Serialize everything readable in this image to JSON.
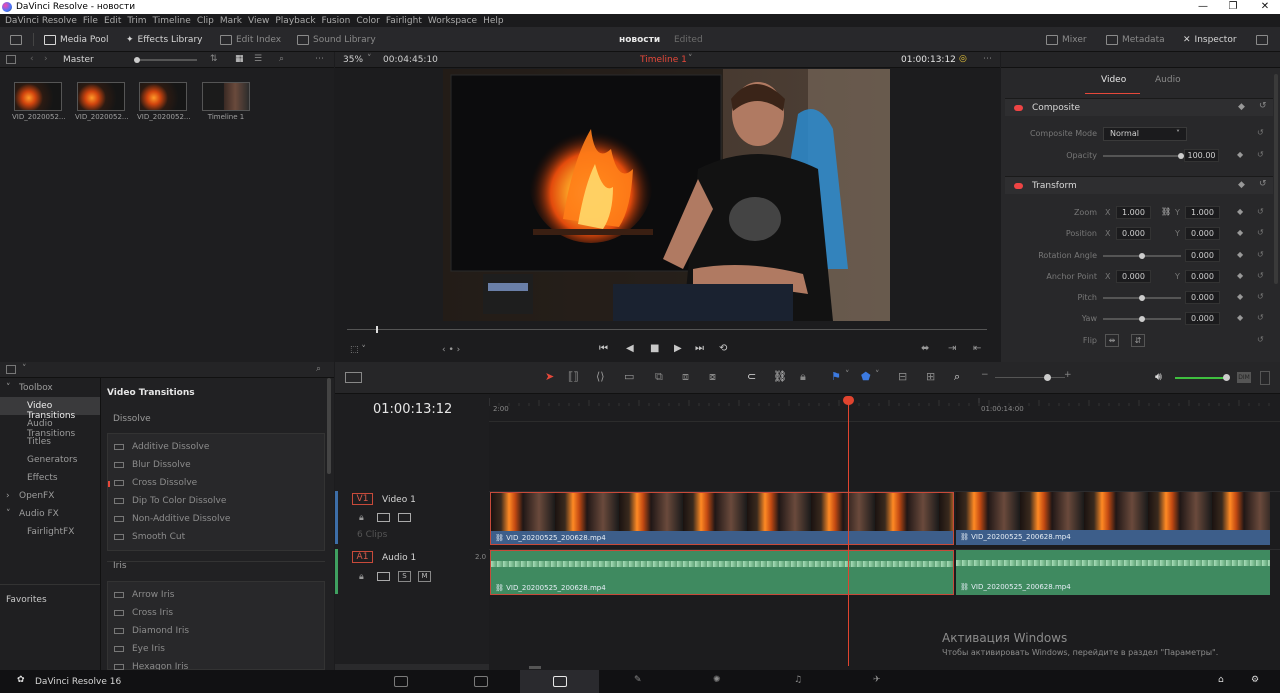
{
  "window": {
    "title": "DaVinci Resolve - новости",
    "controls": [
      "—",
      "❐",
      "✕"
    ]
  },
  "menu": [
    "DaVinci Resolve",
    "File",
    "Edit",
    "Trim",
    "Timeline",
    "Clip",
    "Mark",
    "View",
    "Playback",
    "Fusion",
    "Color",
    "Fairlight",
    "Workspace",
    "Help"
  ],
  "toolbar": {
    "media_pool": "Media Pool",
    "effects_library": "Effects Library",
    "edit_index": "Edit Index",
    "sound_library": "Sound Library",
    "project_name": "новости",
    "project_status": "Edited",
    "mixer": "Mixer",
    "metadata": "Metadata",
    "inspector": "Inspector"
  },
  "media_pool": {
    "bin": "Master",
    "clips": [
      {
        "label": "VID_2020052..."
      },
      {
        "label": "VID_2020052..."
      },
      {
        "label": "VID_2020052..."
      },
      {
        "label": "Timeline 1"
      }
    ]
  },
  "viewer": {
    "zoom": "35%",
    "duration": "00:04:45:10",
    "timeline_name": "Timeline 1",
    "timecode": "01:00:13:12"
  },
  "inspector": {
    "tabs": [
      "Video",
      "Audio"
    ],
    "active_tab": "Video",
    "composite": {
      "title": "Composite",
      "mode_label": "Composite Mode",
      "mode_value": "Normal",
      "opacity_label": "Opacity",
      "opacity_value": "100.00",
      "opacity_fraction": 1.0
    },
    "transform": {
      "title": "Transform",
      "zoom_label": "Zoom",
      "zoom_x": "1.000",
      "zoom_y": "1.000",
      "position_label": "Position",
      "position_x": "0.000",
      "position_y": "0.000",
      "rotation_label": "Rotation Angle",
      "rotation_value": "0.000",
      "anchor_label": "Anchor Point",
      "anchor_x": "0.000",
      "anchor_y": "0.000",
      "pitch_label": "Pitch",
      "pitch_value": "0.000",
      "yaw_label": "Yaw",
      "yaw_value": "0.000",
      "flip_label": "Flip",
      "axis_x": "X",
      "axis_y": "Y"
    }
  },
  "toolbox": {
    "tree": [
      {
        "label": "Toolbox",
        "arrow": "˅"
      },
      {
        "label": "Video Transitions",
        "selected": true
      },
      {
        "label": "Audio Transitions"
      },
      {
        "label": "Titles"
      },
      {
        "label": "Generators"
      },
      {
        "label": "Effects"
      },
      {
        "label": "OpenFX",
        "arrow": "›"
      },
      {
        "label": "Audio FX",
        "arrow": "˅"
      },
      {
        "label": "FairlightFX"
      }
    ],
    "favorites": "Favorites",
    "list_title": "Video Transitions",
    "groups": [
      {
        "name": "Dissolve",
        "items": [
          "Additive Dissolve",
          "Blur Dissolve",
          "Cross Dissolve",
          "Dip To Color Dissolve",
          "Non-Additive Dissolve",
          "Smooth Cut"
        ]
      },
      {
        "name": "Iris",
        "items": [
          "Arrow Iris",
          "Cross Iris",
          "Diamond Iris",
          "Eye Iris",
          "Hexagon Iris"
        ]
      }
    ]
  },
  "timeline": {
    "timecode": "01:00:13:12",
    "ruler_marks": [
      "2:00",
      "01:00:14:00"
    ],
    "video_track": {
      "badge": "V1",
      "name": "Video 1",
      "clip_count": "6 Clips"
    },
    "audio_track": {
      "badge": "A1",
      "name": "Audio 1",
      "channels": "2.0",
      "solo": "S",
      "mute": "M"
    },
    "clip_name": "VID_20200525_200628.mp4"
  },
  "bottombar": {
    "app_label": "DaVinci Resolve 16",
    "pages": [
      "media-page",
      "cut-page",
      "edit-page",
      "fusion-page",
      "color-page",
      "fairlight-page",
      "deliver-page"
    ],
    "active_page": "edit-page"
  },
  "watermark": {
    "title": "Активация Windows",
    "subtitle": "Чтобы активировать Windows, перейдите в раздел \"Параметры\"."
  },
  "colors": {
    "accent_red": "#e6483a",
    "video_clip": "#3d5e8a",
    "audio_clip": "#3f8a60",
    "playhead": "#e0442f"
  }
}
